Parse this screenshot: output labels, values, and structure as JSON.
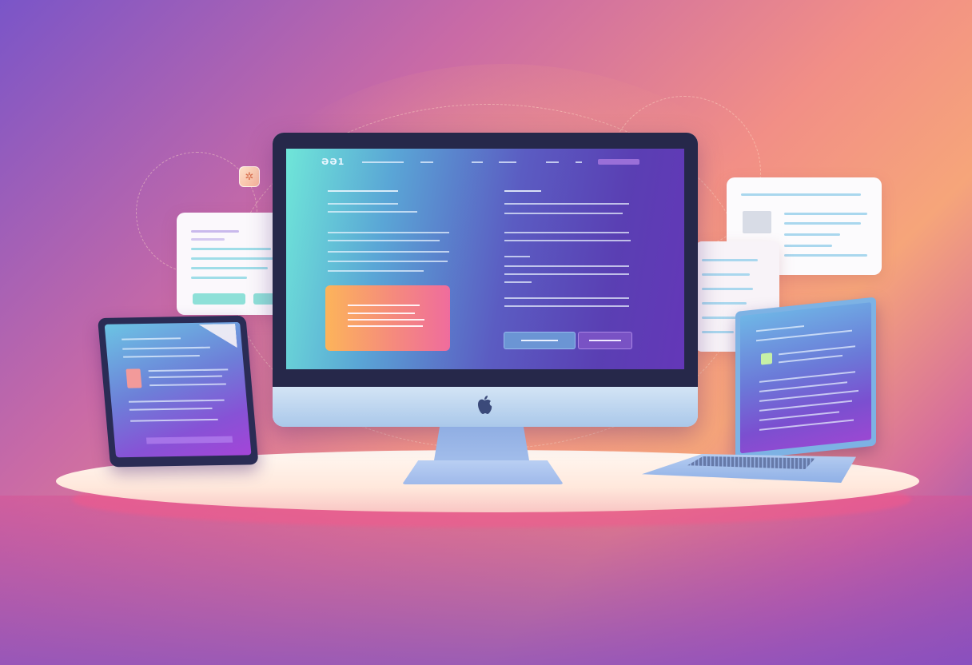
{
  "colors": {
    "accent_teal": "#8ee0d8",
    "accent_orange": "#fcb45a",
    "accent_pink": "#ef6c9d",
    "accent_purple": "#7952c4"
  },
  "icons": {
    "monitor_logo": "apple-logo-icon",
    "floating_icon": "sparkle-icon"
  },
  "monitor": {
    "nav_logo": "ƏƏ1"
  }
}
